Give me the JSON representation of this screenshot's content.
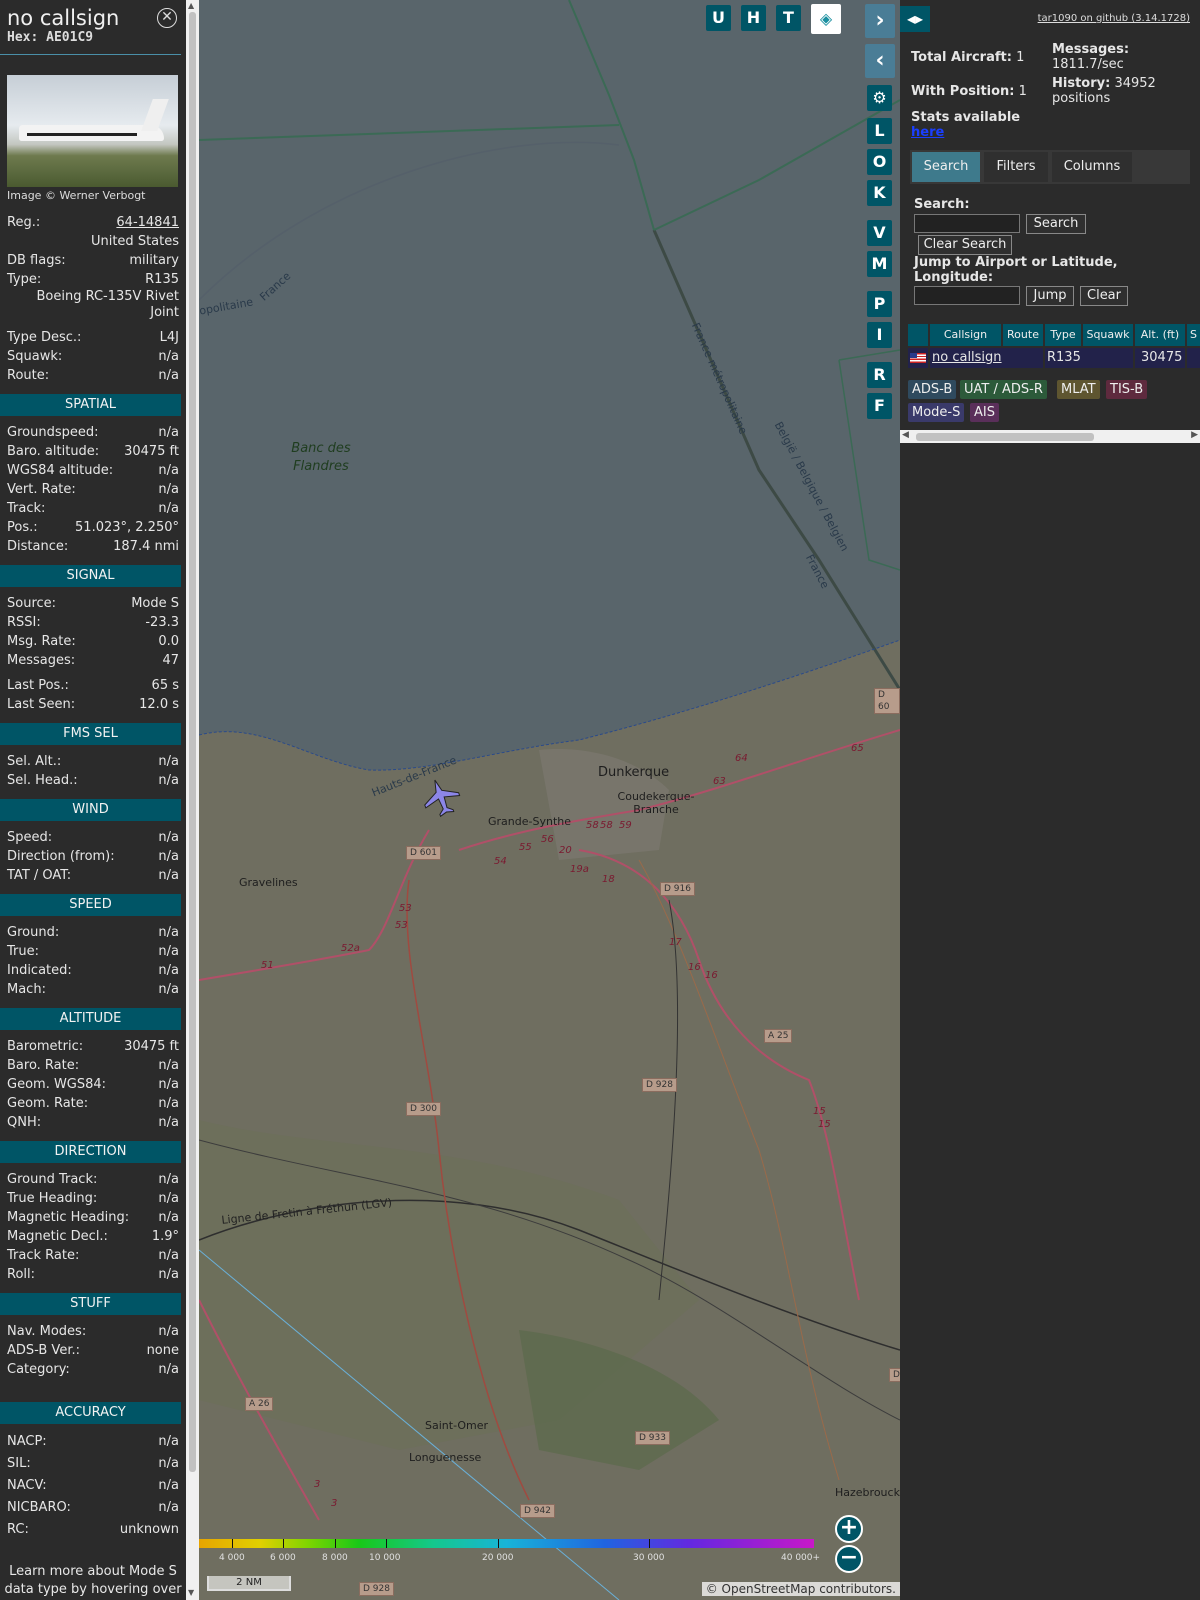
{
  "aircraft": {
    "callsign": "no callsign",
    "hex": "Hex: AE01C9",
    "image_credit": "Image © Werner Verbogt",
    "reg_label": "Reg.:",
    "reg": "64-14841",
    "country": "United States",
    "dbflags_label": "DB flags:",
    "dbflags": "military",
    "type_label": "Type:",
    "type": "R135",
    "type_full": "Boeing RC-135V Rivet Joint",
    "typedesc_label": "Type Desc.:",
    "typedesc": "L4J",
    "squawk_label": "Squawk:",
    "squawk": "n/a",
    "route_label": "Route:",
    "route": "n/a"
  },
  "sections": {
    "spatial": "SPATIAL",
    "signal": "SIGNAL",
    "fms": "FMS SEL",
    "wind": "WIND",
    "speed": "SPEED",
    "altitude": "ALTITUDE",
    "direction": "DIRECTION",
    "stuff": "STUFF",
    "accuracy": "ACCURACY"
  },
  "spatial": [
    [
      "Groundspeed:",
      "n/a"
    ],
    [
      "Baro. altitude:",
      "30475 ft"
    ],
    [
      "WGS84 altitude:",
      "n/a"
    ],
    [
      "Vert. Rate:",
      "n/a"
    ],
    [
      "Track:",
      "n/a"
    ],
    [
      "Pos.:",
      "51.023°, 2.250°"
    ],
    [
      "Distance:",
      "187.4 nmi"
    ]
  ],
  "signal": [
    [
      "Source:",
      "Mode S"
    ],
    [
      "RSSI:",
      "-23.3"
    ],
    [
      "Msg. Rate:",
      "0.0"
    ],
    [
      "Messages:",
      "47"
    ]
  ],
  "signal2": [
    [
      "Last Pos.:",
      "65 s"
    ],
    [
      "Last Seen:",
      "12.0 s"
    ]
  ],
  "fms": [
    [
      "Sel. Alt.:",
      "n/a"
    ],
    [
      "Sel. Head.:",
      "n/a"
    ]
  ],
  "wind": [
    [
      "Speed:",
      "n/a"
    ],
    [
      "Direction (from):",
      "n/a"
    ],
    [
      "TAT / OAT:",
      "n/a"
    ]
  ],
  "speed": [
    [
      "Ground:",
      "n/a"
    ],
    [
      "True:",
      "n/a"
    ],
    [
      "Indicated:",
      "n/a"
    ],
    [
      "Mach:",
      "n/a"
    ]
  ],
  "altitude": [
    [
      "Barometric:",
      "30475 ft"
    ],
    [
      "Baro. Rate:",
      "n/a"
    ],
    [
      "Geom. WGS84:",
      "n/a"
    ],
    [
      "Geom. Rate:",
      "n/a"
    ],
    [
      "QNH:",
      "n/a"
    ]
  ],
  "direction": [
    [
      "Ground Track:",
      "n/a"
    ],
    [
      "True Heading:",
      "n/a"
    ],
    [
      "Magnetic Heading:",
      "n/a"
    ],
    [
      "Magnetic Decl.:",
      "1.9°"
    ],
    [
      "Track Rate:",
      "n/a"
    ],
    [
      "Roll:",
      "n/a"
    ]
  ],
  "stuff": [
    [
      "Nav. Modes:",
      "n/a"
    ],
    [
      "ADS-B Ver.:",
      "none"
    ],
    [
      "Category:",
      "n/a"
    ]
  ],
  "accuracy": [
    [
      "NACP:",
      "n/a"
    ],
    [
      "SIL:",
      "n/a"
    ],
    [
      "NACV:",
      "n/a"
    ],
    [
      "NICBARO:",
      "n/a"
    ],
    [
      "RC:",
      "unknown"
    ]
  ],
  "note": "Learn more about Mode S data type by hovering over each data label.",
  "map": {
    "labels": {
      "dunkerque": "Dunkerque",
      "coudekerque": "Coudekerque-Branche",
      "grande_synthe": "Grande-Synthe",
      "gravelines": "Gravelines",
      "saint_omer": "Saint-Omer",
      "longuenesse": "Longuenesse",
      "hazebrouck": "Hazebrouck",
      "banc": "Banc des Flandres",
      "hauts": "Hauts-de-France",
      "france_metro": "France métropolitaine",
      "belgie": "België / Belgique / Belgien",
      "france": "France",
      "france2": "France",
      "metro_left": "opolitaine",
      "lgv": "Ligne de Fretin à Fréthun (LGV)"
    },
    "roads": [
      "D 601",
      "D 916",
      "A 25",
      "D 928",
      "D 300",
      "A 26",
      "D 933",
      "D 942",
      "D 928",
      "D 60",
      "D"
    ],
    "road_nums": [
      "64",
      "63",
      "65",
      "58",
      "58",
      "59",
      "56",
      "55",
      "54",
      "20",
      "19a",
      "18",
      "53",
      "53",
      "52a",
      "51",
      "17",
      "16",
      "16",
      "15",
      "15",
      "3",
      "3"
    ],
    "buttons": {
      "u": "U",
      "h": "H",
      "t": "T",
      "l": "L",
      "o": "O",
      "k": "K",
      "v": "V",
      "m": "M",
      "p": "P",
      "i": "I",
      "r": "R",
      "f": "F"
    },
    "zoom_in": "+",
    "zoom_out": "−",
    "colorbar_ticks": [
      "4 000",
      "6 000",
      "8 000",
      "10 000",
      "20 000",
      "30 000",
      "40 000+"
    ],
    "scale": "2 NM",
    "attribution": "© OpenStreetMap contributors."
  },
  "right": {
    "github": "tar1090 on github (3.14.1728)",
    "total_label": "Total Aircraft:",
    "total": "1",
    "withpos_label": "With Position:",
    "withpos": "1",
    "stats_label": "Stats available",
    "stats_link": "here",
    "messages_label": "Messages:",
    "messages": "1811.7/sec",
    "history_label": "History:",
    "history": "34952 positions",
    "tabs": [
      "Search",
      "Filters",
      "Columns"
    ],
    "search_label": "Search:",
    "search_btn": "Search",
    "clear_search": "Clear Search",
    "jump_label": "Jump to Airport or Latitude, Longitude:",
    "jump_btn": "Jump",
    "clear_btn": "Clear",
    "columns": [
      "Callsign",
      "Route",
      "Type",
      "Squawk",
      "Alt. (ft)",
      "S"
    ],
    "row": {
      "callsign": "no callsign",
      "route": "",
      "type": "R135",
      "squawk": "",
      "alt": "30475"
    },
    "badges": [
      "ADS-B",
      "UAT / ADS-R",
      "MLAT",
      "TIS-B",
      "Mode-S",
      "AIS"
    ],
    "badge_colors": [
      "#2f4a5e",
      "#2c5a3a",
      "#5e5530",
      "#5e2a3e",
      "#3a3a6a",
      "#5a2f5a"
    ]
  }
}
